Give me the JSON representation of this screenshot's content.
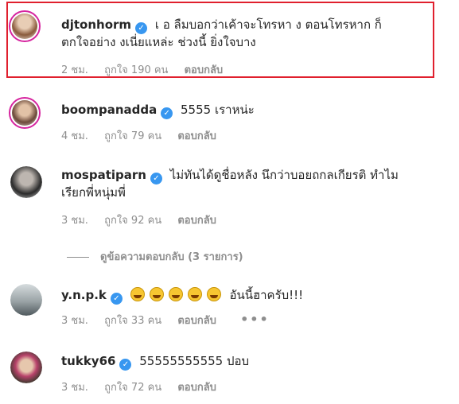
{
  "comments": [
    {
      "username": "djtonhorm",
      "text_line1": "เ   อ   ลืมบอกว่าเค้าจะโทรหา   ง ตอนโทรหาก   ก็",
      "text_line2": "ตกใจอย่าง   งเนี่ยแหล่ะ ช่วงนี้   ยิ่งใจบาง",
      "time": "2 ชม.",
      "likes": "ถูกใจ 190 คน",
      "reply": "ตอบกลับ",
      "avatar_color": "#c9a58a"
    },
    {
      "username": "boompanadda",
      "text_line1": "5555 เราหน่ะ",
      "time": "4 ชม.",
      "likes": "ถูกใจ 79 คน",
      "reply": "ตอบกลับ",
      "avatar_color": "#b58a6e"
    },
    {
      "username": "mospatiparn",
      "text_line1": "ไม่ทันได้ดูชื่อหลัง   นึกว่าบอยถกลเกียรติ ทำไม",
      "text_line2": "เรียกพี่หนุ่มพี่",
      "time": "3 ชม.",
      "likes": "ถูกใจ 92 คน",
      "reply": "ตอบกลับ",
      "avatar_color": "#3a3a3a"
    },
    {
      "username": "y.n.p.k",
      "text_line1": "อันนี้ฮาครับ!!!",
      "time": "3 ชม.",
      "likes": "ถูกใจ 33 คน",
      "reply": "ตอบกลับ",
      "more": "•••",
      "avatar_color": "#7d8a8f"
    },
    {
      "username": "tukky66",
      "text_line1": "55555555555   ปอบ",
      "time": "3 ชม.",
      "likes": "ถูกใจ 72 คน",
      "reply": "ตอบกลับ",
      "avatar_color": "#8a6a5a"
    }
  ],
  "view_replies": "ดูข้อความตอบกลับ (3 รายการ)",
  "highlight_color": "#e0202e",
  "verified_color": "#3897f0"
}
